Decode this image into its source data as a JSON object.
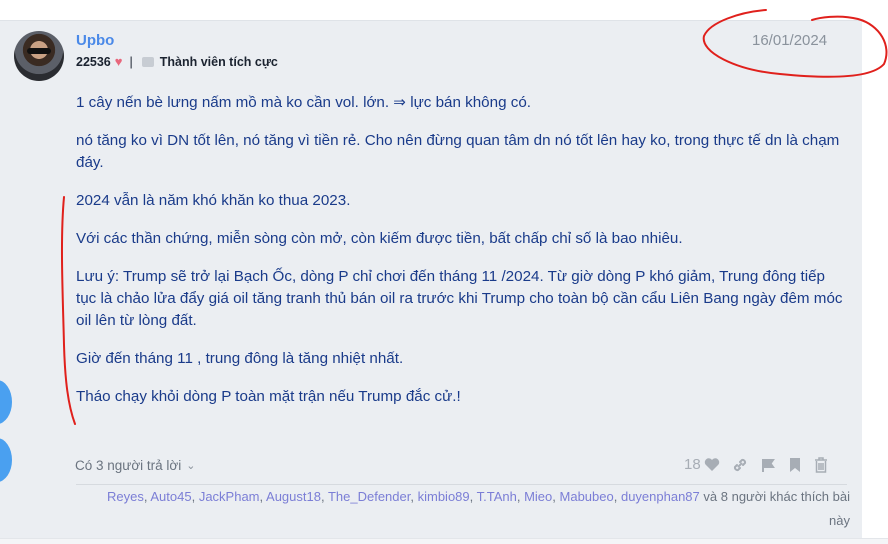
{
  "post": {
    "username": "Upbo",
    "points": "22536",
    "rank": "Thành viên tích cực",
    "date": "16/01/2024",
    "paragraphs": [
      "1 cây nến bè lưng nấm mồ mà ko cần vol. lớn. ⇒ lực bán không có.",
      "nó tăng ko vì DN tốt lên, nó tăng vì tiền rẻ. Cho nên đừng quan tâm dn nó tốt lên hay ko, trong thực tế dn là chạm đáy.",
      "2024 vẫn là năm khó khăn ko thua 2023.",
      "Với các thần chứng, miễn sòng còn mở, còn kiếm được tiền, bất chấp chỉ số là bao nhiêu.",
      "Lưu ý: Trump sẽ trở lại Bạch Ốc, dòng P chỉ chơi đến tháng 11 /2024. Từ giờ dòng P khó giảm, Trung đông tiếp tục là chảo lửa đẩy giá oil tăng tranh thủ bán oil ra trước khi Trump cho toàn bộ cần cẩu Liên Bang ngày đêm móc oil lên từ lòng đất.",
      "Giờ đến tháng 11 , trung đông là tăng nhiệt nhất.",
      "Tháo chạy khỏi dòng P toàn mặt trận nếu Trump đắc cử.!"
    ]
  },
  "footer": {
    "replies": "Có 3 người trả lời",
    "like_count": "18",
    "likers": [
      "Reyes",
      "Auto45",
      "JackPham",
      "August18",
      "The_Defender",
      "kimbio89",
      "T.TAnh",
      "Mieo",
      "Mabubeo",
      "duyenphan87"
    ],
    "likers_suffix": "và 8 người khác thích bài này"
  },
  "colors": {
    "accent": "#4a89e8",
    "body_text": "#1a3b8a",
    "annotation": "#e0201c"
  }
}
